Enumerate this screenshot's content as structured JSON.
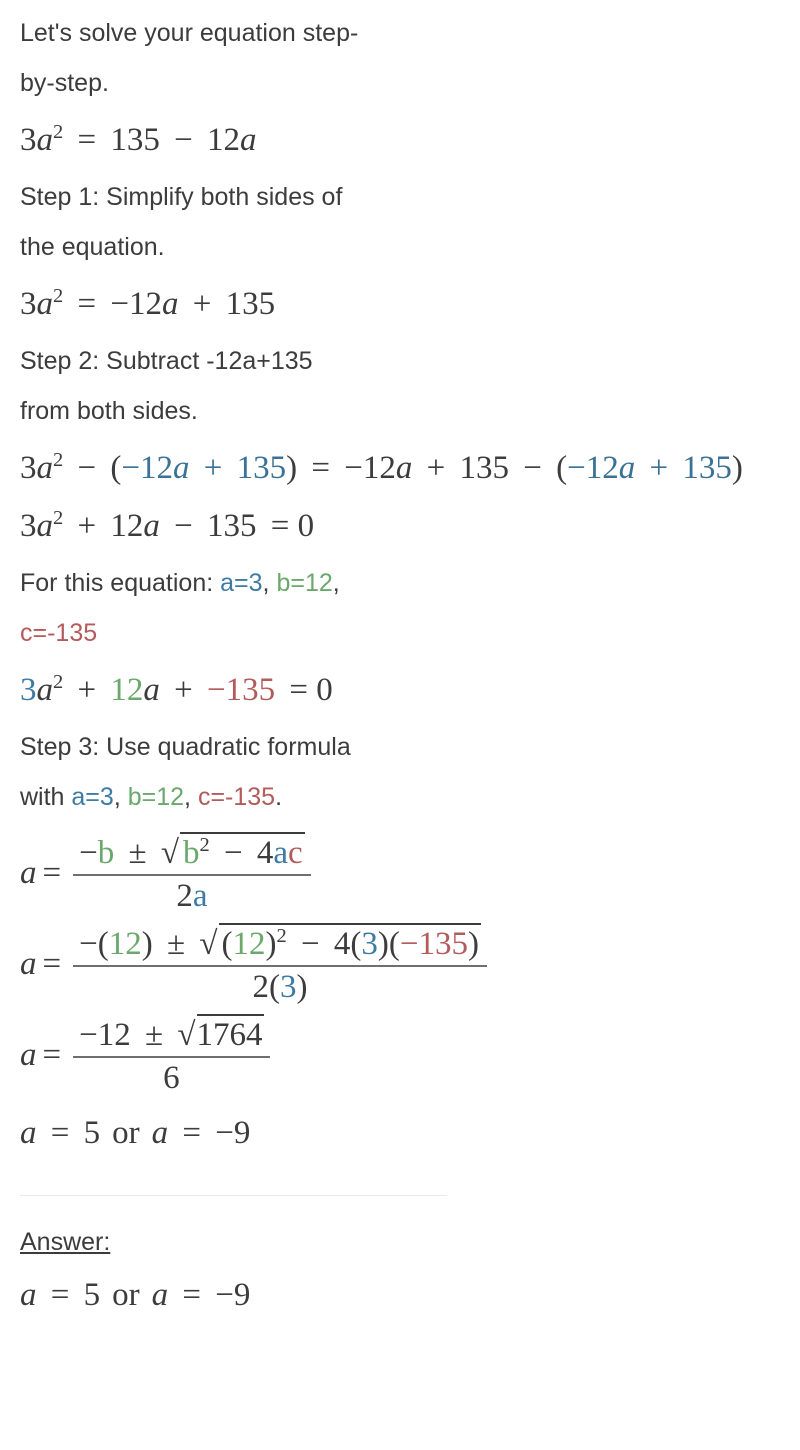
{
  "intro": {
    "line1": "Let's solve your equation step-",
    "line2": "by-step."
  },
  "original_equation": {
    "lhs_coeff": "3",
    "lhs_var": "a",
    "lhs_exp": "2",
    "eq": "=",
    "rhs_const": "135",
    "rhs_op": "−",
    "rhs_coeff": "12",
    "rhs_var": "a"
  },
  "step1": {
    "label_line1": "Step 1: Simplify both sides of",
    "label_line2": "the equation.",
    "eq_lhs_coeff": "3",
    "eq_lhs_var": "a",
    "eq_lhs_exp": "2",
    "eq_sign": "=",
    "eq_rhs_neg": "−12",
    "eq_rhs_var": "a",
    "eq_rhs_op": "+",
    "eq_rhs_const": "135"
  },
  "step2": {
    "label_line1": "Step 2: Subtract -12a+135",
    "label_line2": "from both sides.",
    "eq_lhs_coeff": "3",
    "eq_lhs_var": "a",
    "eq_lhs_exp": "2",
    "minus": "−",
    "paren_open": "(",
    "paren_close": ")",
    "blue_neg12": "−12",
    "blue_var": "a",
    "blue_plus": "+",
    "blue_135": "135",
    "equals": "=",
    "rhs_neg12": "−12",
    "rhs_var": "a",
    "rhs_plus": "+",
    "rhs_135": "135",
    "rhs_minus": "−",
    "result_coeff": "3",
    "result_var": "a",
    "result_exp": "2",
    "result_plus": "+",
    "result_12": "12",
    "result_var2": "a",
    "result_minus": "−",
    "result_135": "135",
    "result_eq": "= 0"
  },
  "coefficients": {
    "prefix": "For this equation: ",
    "a_label": "a=3",
    "comma1": ", ",
    "b_label": "b=12",
    "comma2": ",",
    "c_label": "c=-135",
    "colored_eq": {
      "coeff3": "3",
      "var_a": "a",
      "exp2": "2",
      "plus1": "+",
      "twelve": "12",
      "var_a2": "a",
      "plus2": "+",
      "neg135": "−135",
      "eq_zero": "= 0"
    }
  },
  "step3": {
    "label_line1": "Step 3: Use quadratic formula",
    "label_with": "with ",
    "a_label": "a=3",
    "comma1": ", ",
    "b_label": "b=12",
    "comma2": ", ",
    "c_label": "c=-135",
    "period": "."
  },
  "formula_general": {
    "lhs": "a",
    "eq": "=",
    "num_minus": "−",
    "num_b": "b",
    "num_pm": "±",
    "radical": "√",
    "rad_b": "b",
    "rad_exp": "2",
    "rad_minus": "−",
    "rad_four": "4",
    "rad_a": "a",
    "rad_c": "c",
    "den_two": "2",
    "den_a": "a"
  },
  "formula_substituted": {
    "lhs": "a",
    "eq": "=",
    "num_minus": "−",
    "num_open": "(",
    "num_12": "12",
    "num_close": ")",
    "num_pm": "±",
    "radical": "√",
    "rad_open": "(",
    "rad_12": "12",
    "rad_close": ")",
    "rad_exp": "2",
    "rad_minus": "−",
    "rad_four": "4",
    "rad_open2": "(",
    "rad_3": "3",
    "rad_close2": ")",
    "rad_open3": "(",
    "rad_neg135": "−135",
    "rad_close3": ")",
    "den_two": "2",
    "den_open": "(",
    "den_3": "3",
    "den_close": ")"
  },
  "formula_evaluated": {
    "lhs": "a",
    "eq": "=",
    "num_neg12": "−12",
    "num_pm": "±",
    "radical": "√",
    "rad_value": "1764",
    "den": "6"
  },
  "solution": {
    "lhs1": "a",
    "eq1": "=",
    "val1": "5",
    "or": "or",
    "lhs2": "a",
    "eq2": "=",
    "val2": "−9"
  },
  "answer": {
    "label": "Answer:",
    "lhs1": "a",
    "eq1": "=",
    "val1": "5",
    "or": "or",
    "lhs2": "a",
    "eq2": "=",
    "val2": "−9"
  },
  "colors": {
    "text": "#3c3c3c",
    "blue": "#3d7ba5",
    "blue_dark": "#3a7296",
    "green": "#6aa96b",
    "red": "#b35b5b",
    "divider": "#e9e9e9"
  }
}
